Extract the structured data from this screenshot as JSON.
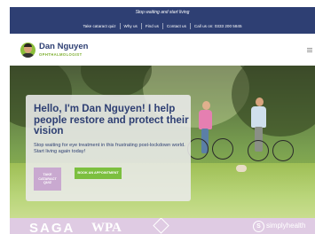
{
  "topbar": {
    "tagline": "Stop waiting and start living",
    "nav": [
      {
        "label": "Take cataract quiz"
      },
      {
        "label": "Why us"
      },
      {
        "label": "Find us"
      },
      {
        "label": "Contact us"
      },
      {
        "label": "Call us on: 0333 200 5845"
      }
    ]
  },
  "header": {
    "name": "Dan Nguyen",
    "role": "OPHTHALMOLOGIST",
    "menu_icon": "hamburger-menu-icon"
  },
  "hero": {
    "heading": "Hello, I'm Dan Nguyen! I help people restore and protect their vision",
    "subtext": "Stop waiting for eye treatment in this frustrating post-lockdown world. Start living again today!",
    "quiz_button": "TAKE CATARACT QUIZ",
    "book_button": "BOOK AN APPOINTMENT"
  },
  "partners": {
    "logo_1": "SAGA",
    "logo_2": "WPA",
    "logo_5_mark": "S",
    "logo_5": "simplyhealth"
  },
  "colors": {
    "navy": "#2e3f73",
    "green": "#7cbf3f",
    "lilac": "#c9a9d0",
    "partner_bar": "#dfcbe3"
  }
}
